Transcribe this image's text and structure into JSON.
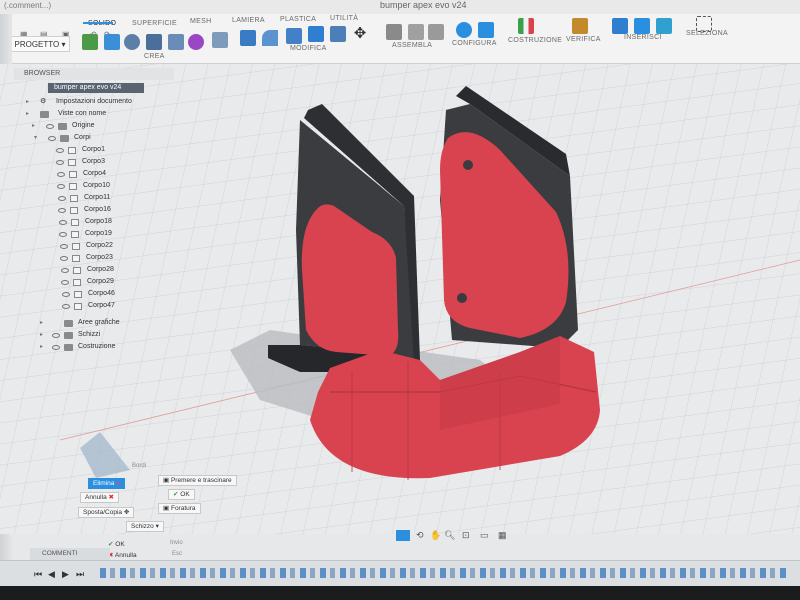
{
  "window": {
    "title": "bumper apex evo v24",
    "corner_text": "(.comment...)"
  },
  "toolbar": {
    "workspace_button": "PROGETTO",
    "tabs": [
      "SOLIDO",
      "SUPERFICIE",
      "MESH",
      "LAMIERA",
      "PLASTICA",
      "UTILITÀ"
    ],
    "active_tab": "SOLIDO",
    "groups": [
      "CREA",
      "MODIFICA",
      "ASSEMBLA",
      "CONFIGURA",
      "COSTRUZIONE",
      "VERIFICA",
      "INSERISCI",
      "SELEZIONA"
    ]
  },
  "browser": {
    "header": "BROWSER",
    "document_node": "bumper apex evo v24",
    "items": [
      "Impostazioni documento",
      "Viste con nome",
      "Origine",
      "Corpi",
      "Corpo1",
      "Corpo3",
      "Corpo4",
      "Corpo10",
      "Corpo11",
      "Corpo16",
      "Corpo18",
      "Corpo19",
      "Corpo22",
      "Corpo23",
      "Corpo28",
      "Corpo29",
      "Corpo46",
      "Corpo47",
      "Aree grafiche",
      "Schizzi",
      "Costruzione"
    ]
  },
  "dialog": {
    "title": "Bordi",
    "elimina": "Elimina",
    "annulla": "Annulla",
    "sposta_copia": "Sposta/Copia",
    "premere_trascinare": "Premere e trascinare",
    "ok": "OK",
    "foratura": "Foratura",
    "schizzo": "Schizzo",
    "ok2": "OK",
    "annulla2": "Annulla",
    "invio": "Invio",
    "esc": "Esc"
  },
  "comments": {
    "label": "COMMENTI"
  },
  "colors": {
    "accent": "#2b8fe0",
    "body_red": "#d9434f",
    "body_dark": "#3a3b3e"
  }
}
